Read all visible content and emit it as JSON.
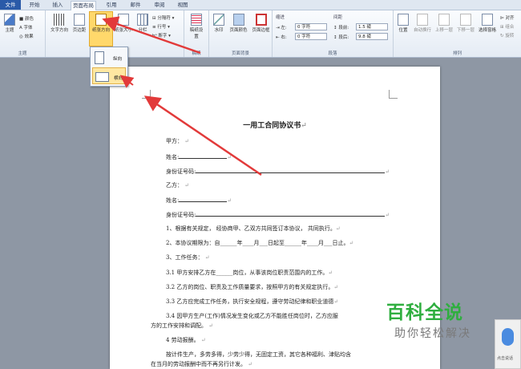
{
  "tabs": [
    {
      "label": "文件",
      "state": "file"
    },
    {
      "label": "开始",
      "state": ""
    },
    {
      "label": "插入",
      "state": ""
    },
    {
      "label": "页面布局",
      "state": "active"
    },
    {
      "label": "引用",
      "state": ""
    },
    {
      "label": "邮件",
      "state": ""
    },
    {
      "label": "审阅",
      "state": ""
    },
    {
      "label": "视图",
      "state": ""
    }
  ],
  "ribbon": {
    "theme": {
      "button": "主题",
      "colors": "颜色",
      "fonts": "字体",
      "effects": "效果",
      "group": "主题"
    },
    "page_setup": {
      "text_direction": "文字方向",
      "margins": "页边距",
      "orientation": "纸张方向",
      "size": "纸张大小",
      "columns": "分栏",
      "breaks": "分隔符",
      "line_numbers": "行号",
      "hyphenation": "断字"
    },
    "draft": {
      "button": "稿纸设置",
      "group": "稿纸"
    },
    "background": {
      "watermark": "水印",
      "page_color": "页面颜色",
      "page_border": "页面边框",
      "group": "页面背景"
    },
    "paragraph": {
      "indent": "缩进",
      "left": "左:",
      "left_val": "0 字符",
      "right": "右:",
      "right_val": "0 字符",
      "spacing": "间距",
      "before": "段前:",
      "before_val": "1.5 磅",
      "after": "段后:",
      "after_val": "9.8 磅",
      "group": "段落"
    },
    "arrange": {
      "position": "位置",
      "wrap": "自动换行",
      "forward": "上移一层",
      "backward": "下移一层",
      "pane": "选择窗格",
      "align": "对齐",
      "group_btn": "组合",
      "rotate": "旋转",
      "group": "排列"
    }
  },
  "orientation_menu": {
    "portrait": "纵向",
    "landscape": "横向"
  },
  "document": {
    "title": "一用工合同协议书",
    "lines": [
      "甲方：",
      "姓名:",
      "身份证号码:",
      "乙方：",
      "姓名:",
      "身份证号码:",
      "1、根据有关规定， 经协商甲、乙双方共同签订本协议， 共同执行。",
      "2、本协议期限为：自______年____月___日起至______年____月___日止。",
      "3、工作任务：",
      "3.1 甲方安排乙方在______岗位，从事该岗位职责范围内的工作。",
      "3.2 乙方的岗位、职责及工作质量要求，按照甲方的有关规定执行。",
      "3.3 乙方应完成工作任务，执行安全规程，遵守劳动纪律和职业道德",
      "3.4 因甲方生产(工作)情况发生变化或乙方不能胜任岗位时，乙方应服",
      "方的工作安排和调配。",
      "4 劳动报酬。",
      "按计件生产，多劳多得，少劳少得，无固定工资，其它各种福利、津贴均含",
      "在当月的劳动报酬中而不再另行计发。"
    ]
  },
  "watermark": {
    "main": "百科全说",
    "sub": "助你轻松解决"
  },
  "voice": {
    "label": "点击说话"
  },
  "colors": {
    "accent": "#2a5aa8",
    "arrow": "#e23a3a",
    "highlight": "#ffd86b",
    "brand": "#2fae3f"
  }
}
